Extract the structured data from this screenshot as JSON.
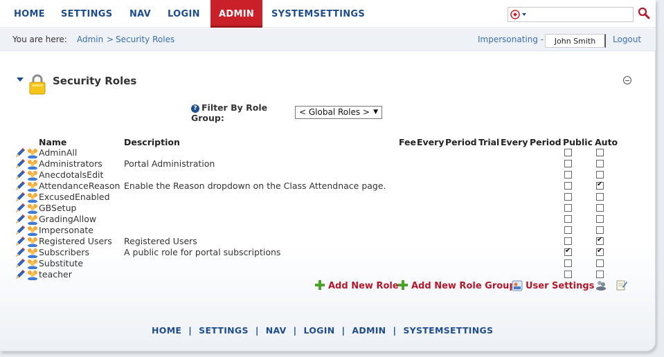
{
  "top_nav": {
    "items": [
      {
        "label": "HOME"
      },
      {
        "label": "SETTINGS"
      },
      {
        "label": "NAV"
      },
      {
        "label": "LOGIN"
      },
      {
        "label": "ADMIN",
        "active": true
      },
      {
        "label": "SYSTEMSETTINGS"
      }
    ],
    "search_placeholder": "",
    "search_icon": "magnifier-icon",
    "accent_color": "#c9202a",
    "nav_color": "#1f4d8c"
  },
  "breadcrumb": {
    "label": "You are here:",
    "items": [
      "Admin",
      "Security Roles"
    ],
    "separator": ">"
  },
  "user_bar": {
    "impersonating_label": "Impersonating -",
    "impersonated_user": "John Smith",
    "logout": "Logout"
  },
  "module": {
    "title": "Security Roles",
    "filter_label": "Filter By Role Group:",
    "filter_value": "< Global Roles >"
  },
  "table": {
    "headers": {
      "name": "Name",
      "description": "Description",
      "fee": "Fee",
      "every": "Every",
      "period": "Period",
      "trial": "Trial",
      "every2": "Every",
      "period2": "Period",
      "public": "Public",
      "auto": "Auto"
    },
    "rows": [
      {
        "name": "AdminAll",
        "description": "",
        "public": false,
        "auto": false
      },
      {
        "name": "Administrators",
        "description": "Portal Administration",
        "public": false,
        "auto": false
      },
      {
        "name": "AnecdotalsEdit",
        "description": "",
        "public": false,
        "auto": false
      },
      {
        "name": "AttendanceReason",
        "description": "Enable the Reason dropdown on the Class Attendnace page.",
        "public": false,
        "auto": true
      },
      {
        "name": "ExcusedEnabled",
        "description": "",
        "public": false,
        "auto": false
      },
      {
        "name": "GBSetup",
        "description": "",
        "public": false,
        "auto": false
      },
      {
        "name": "GradingAllow",
        "description": "",
        "public": false,
        "auto": false
      },
      {
        "name": "Impersonate",
        "description": "",
        "public": false,
        "auto": false
      },
      {
        "name": "Registered Users",
        "description": "Registered Users",
        "public": false,
        "auto": true
      },
      {
        "name": "Subscribers",
        "description": "A public role for portal subscriptions",
        "public": true,
        "auto": true
      },
      {
        "name": "Substitute",
        "description": "",
        "public": false,
        "auto": false
      },
      {
        "name": "teacher",
        "description": "",
        "public": false,
        "auto": false
      }
    ]
  },
  "actions": {
    "add_role": "Add New Role",
    "add_role_group": "Add New Role Group",
    "user_settings": "User Settings"
  },
  "footer_nav": {
    "items": [
      "HOME",
      "SETTINGS",
      "NAV",
      "LOGIN",
      "ADMIN",
      "SYSTEMSETTINGS"
    ],
    "separator": "|"
  }
}
